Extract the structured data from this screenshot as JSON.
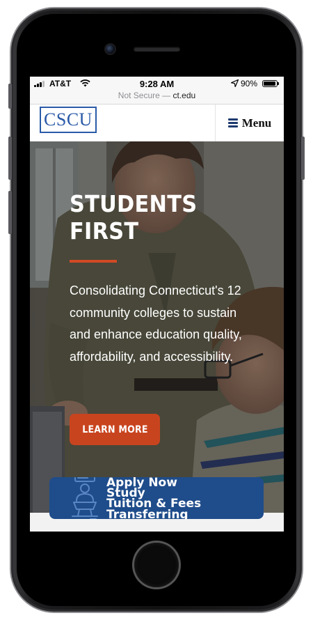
{
  "status_bar": {
    "carrier": "AT&T",
    "time": "9:28 AM",
    "battery": "90%"
  },
  "url_bar": {
    "security": "Not Secure —",
    "host": "ct.edu"
  },
  "header": {
    "logo": "CSCU",
    "menu_label": "Menu"
  },
  "hero": {
    "title_line1": "STUDENTS",
    "title_line2": "FIRST",
    "text": "Consolidating Connecticut's 12 community colleges to sustain and enhance education quality, affordability, and accessibility.",
    "button": "LEARN MORE"
  },
  "quick_links": [
    "Apply Now",
    "Study",
    "Tuition & Fees",
    "Transferring"
  ],
  "colors": {
    "brand_blue": "#2a5aa8",
    "accent_orange": "#c8441f",
    "quicklinks_bg": "#1f4c8a"
  },
  "icons": [
    "signal-icon",
    "wifi-icon",
    "location-arrow-icon",
    "battery-icon",
    "hamburger-menu-icon",
    "person-stack-icon"
  ]
}
